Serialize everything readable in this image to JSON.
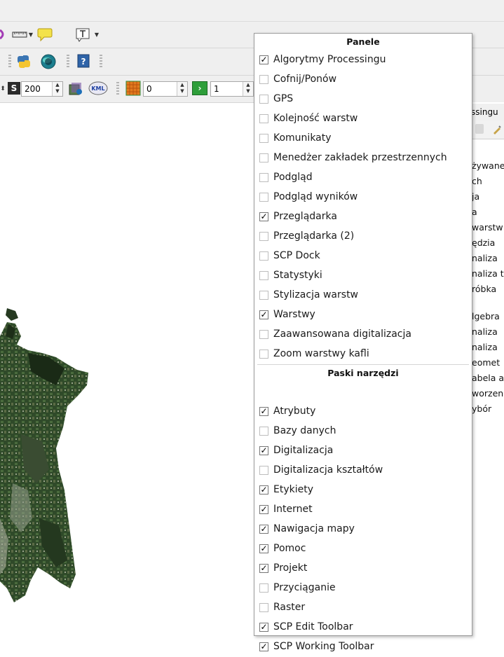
{
  "toolbar": {
    "scale_value": "200",
    "kml_label": "KML",
    "spin1_value": "0",
    "spin2_value": "1",
    "scale_icon_label": "S"
  },
  "side_panel": {
    "title": "ssingu",
    "items": [
      "żywane",
      "ch",
      "ja",
      "a",
      "warstw",
      "ędzia",
      "naliza",
      "naliza t",
      "róbka",
      "lgebra",
      "naliza",
      "naliza",
      "eomet",
      "abela a",
      "worzen",
      "ybór"
    ]
  },
  "menu": {
    "panels_header": "Panele",
    "panels": [
      {
        "label": "Algorytmy Processingu",
        "checked": true
      },
      {
        "label": "Cofnij/Ponów",
        "checked": false
      },
      {
        "label": "GPS",
        "checked": false
      },
      {
        "label": "Kolejność warstw",
        "checked": false
      },
      {
        "label": "Komunikaty",
        "checked": false
      },
      {
        "label": "Menedżer zakładek przestrzennych",
        "checked": false
      },
      {
        "label": "Podgląd",
        "checked": false
      },
      {
        "label": "Podgląd wyników",
        "checked": false
      },
      {
        "label": "Przeglądarka",
        "checked": true
      },
      {
        "label": "Przeglądarka (2)",
        "checked": false
      },
      {
        "label": "SCP Dock",
        "checked": false
      },
      {
        "label": "Statystyki",
        "checked": false
      },
      {
        "label": "Stylizacja warstw",
        "checked": false
      },
      {
        "label": "Warstwy",
        "checked": true
      },
      {
        "label": "Zaawansowana digitalizacja",
        "checked": false
      },
      {
        "label": "Zoom warstwy kafli",
        "checked": false
      }
    ],
    "toolbars_header": "Paski narzędzi",
    "toolbars": [
      {
        "label": "Atrybuty",
        "checked": true
      },
      {
        "label": "Bazy danych",
        "checked": false
      },
      {
        "label": "Digitalizacja",
        "checked": true
      },
      {
        "label": "Digitalizacja kształtów",
        "checked": false
      },
      {
        "label": "Etykiety",
        "checked": true
      },
      {
        "label": "Internet",
        "checked": true
      },
      {
        "label": "Nawigacja mapy",
        "checked": true
      },
      {
        "label": "Pomoc",
        "checked": true
      },
      {
        "label": "Projekt",
        "checked": true
      },
      {
        "label": "Przyciąganie",
        "checked": false
      },
      {
        "label": "Raster",
        "checked": false
      },
      {
        "label": "SCP Edit Toolbar",
        "checked": true
      },
      {
        "label": "SCP Working Toolbar",
        "checked": true
      }
    ],
    "check_glyph": "✓"
  },
  "colors": {
    "map_dark": "#1f3a1c",
    "map_green": "#3d5c34",
    "accent_check": "#000000"
  }
}
